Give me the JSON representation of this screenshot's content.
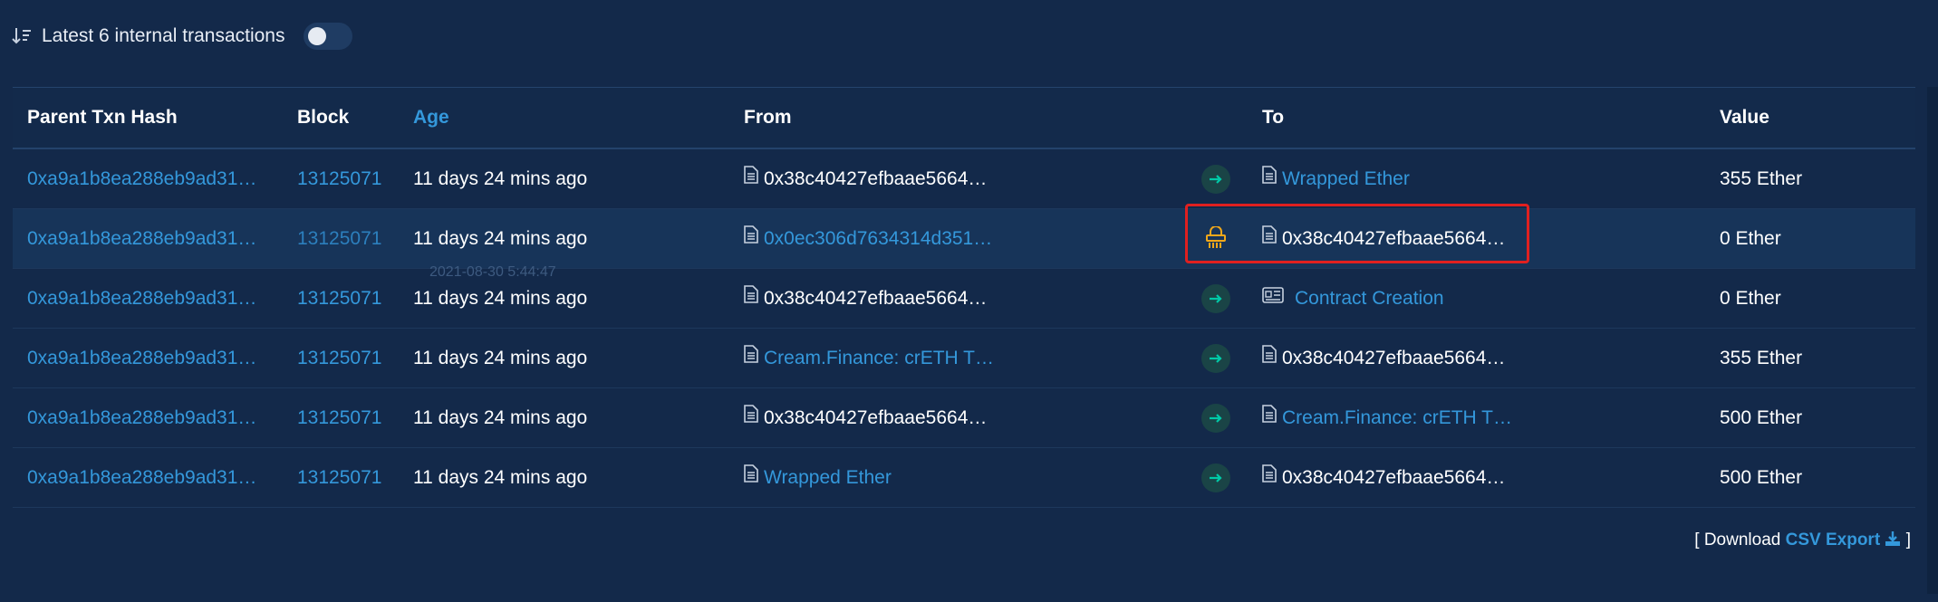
{
  "header": {
    "title": "Latest 6 internal transactions"
  },
  "columns": [
    "Parent Txn Hash",
    "Block",
    "Age",
    "From",
    "To",
    "Value"
  ],
  "rows": [
    {
      "hash": "0xa9a1b8ea288eb9ad31…",
      "block": "13125071",
      "age": "11 days 24 mins ago",
      "from": "0x38c40427efbaae5664…",
      "to": "Wrapped Ether",
      "value": "355 Ether"
    },
    {
      "hash": "0xa9a1b8ea288eb9ad31…",
      "block": "13125071",
      "age": "11 days 24 mins ago",
      "from": "0x0ec306d7634314d351…",
      "to": "0x38c40427efbaae5664…",
      "value": "0 Ether"
    },
    {
      "hash": "0xa9a1b8ea288eb9ad31…",
      "block": "13125071",
      "age": "11 days 24 mins ago",
      "from": "0x38c40427efbaae5664…",
      "to": "Contract Creation",
      "value": "0 Ether"
    },
    {
      "hash": "0xa9a1b8ea288eb9ad31…",
      "block": "13125071",
      "age": "11 days 24 mins ago",
      "from": "Cream.Finance: crETH T…",
      "to": "0x38c40427efbaae5664…",
      "value": "355 Ether"
    },
    {
      "hash": "0xa9a1b8ea288eb9ad31…",
      "block": "13125071",
      "age": "11 days 24 mins ago",
      "from": "0x38c40427efbaae5664…",
      "to": "Cream.Finance: crETH T…",
      "value": "500 Ether"
    },
    {
      "hash": "0xa9a1b8ea288eb9ad31…",
      "block": "13125071",
      "age": "11 days 24 mins ago",
      "from": "Wrapped Ether",
      "to": "0x38c40427efbaae5664…",
      "value": "500 Ether"
    }
  ],
  "tooltip": "2021-08-30 5:44:47",
  "footer": {
    "prefix": "[ Download",
    "export_label": "CSV Export",
    "suffix": "]"
  },
  "colors": {
    "background": "#13294a",
    "link": "#3498db",
    "transfer_green": "#00c9a7",
    "selfdestruct_orange": "#f0a71a",
    "highlight_red": "#e02020"
  }
}
